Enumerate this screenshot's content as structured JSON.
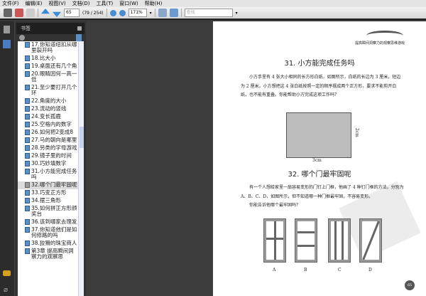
{
  "menu": [
    "文件(F)",
    "编辑(E)",
    "视图(V)",
    "文档(D)",
    "工具(T)",
    "窗口(W)",
    "帮助(H)"
  ],
  "toolbar": {
    "page_input": "65",
    "page_count": "(79 / 254)",
    "zoom": "171%",
    "search_placeholder": "查找"
  },
  "panel": {
    "title": "书签"
  },
  "bookmarks": [
    {
      "label": "17.你知道纽扣从哪里裂开吗"
    },
    {
      "label": "18.比大小"
    },
    {
      "label": "19.桌面还有几个角"
    },
    {
      "label": "20.眼睛因何一高一低"
    },
    {
      "label": "21.至少要打开几个环"
    },
    {
      "label": "22.角度的大小"
    },
    {
      "label": "23.流动的竖线"
    },
    {
      "label": "24.变长孤鹿"
    },
    {
      "label": "25.空格内的数字"
    },
    {
      "label": "26.如何把2变成8"
    },
    {
      "label": "27.马的朝向是哪里"
    },
    {
      "label": "28.另类的字母游戏"
    },
    {
      "label": "29.镜子里的时间"
    },
    {
      "label": "30.巧妙填数字"
    },
    {
      "label": "31.小方能完成任务吗"
    },
    {
      "label": "32.哪个门最牢固呢",
      "selected": true
    },
    {
      "label": "33.巧变正方形"
    },
    {
      "label": "34.摆三角形"
    },
    {
      "label": "35.如何拼正方形颁奖台"
    },
    {
      "label": "36.该到哪家去理发"
    },
    {
      "label": "37.你知道他们是如何修路的吗"
    },
    {
      "label": "38.狡猾的珠宝商人"
    },
    {
      "label": "第3章 提高瞬间洞察力的观察思"
    }
  ],
  "page": {
    "running_header": "提高瞬间洞察力的观察思维游戏",
    "title1": "31. 小方能完成任务吗",
    "para1": "小方手里有 4 张大小相同的长方形白纸，如图所示，白纸的长边为 3 厘米，短边为 2 厘米。小方想把这 4 张白纸按照一定的顺序摆成两个正方形，要求不能剪开白纸，也不能有重叠。你能帮助小方完成这项工作吗？",
    "dim_h": "2cm",
    "dim_w": "3cm",
    "title2": "32. 哪个门最牢固呢",
    "para2": "有一个人想给家里一扇容易变形的门钉上门框，他画了 4 种钉门框的方法，分别为 A、B、C、D，如图所示，但不知道哪一种门框最牢固，不容易变形。",
    "para3": "你能告诉他哪个最牢固吗？",
    "labels": [
      "A",
      "B",
      "C",
      "D"
    ],
    "page_number": "65"
  }
}
